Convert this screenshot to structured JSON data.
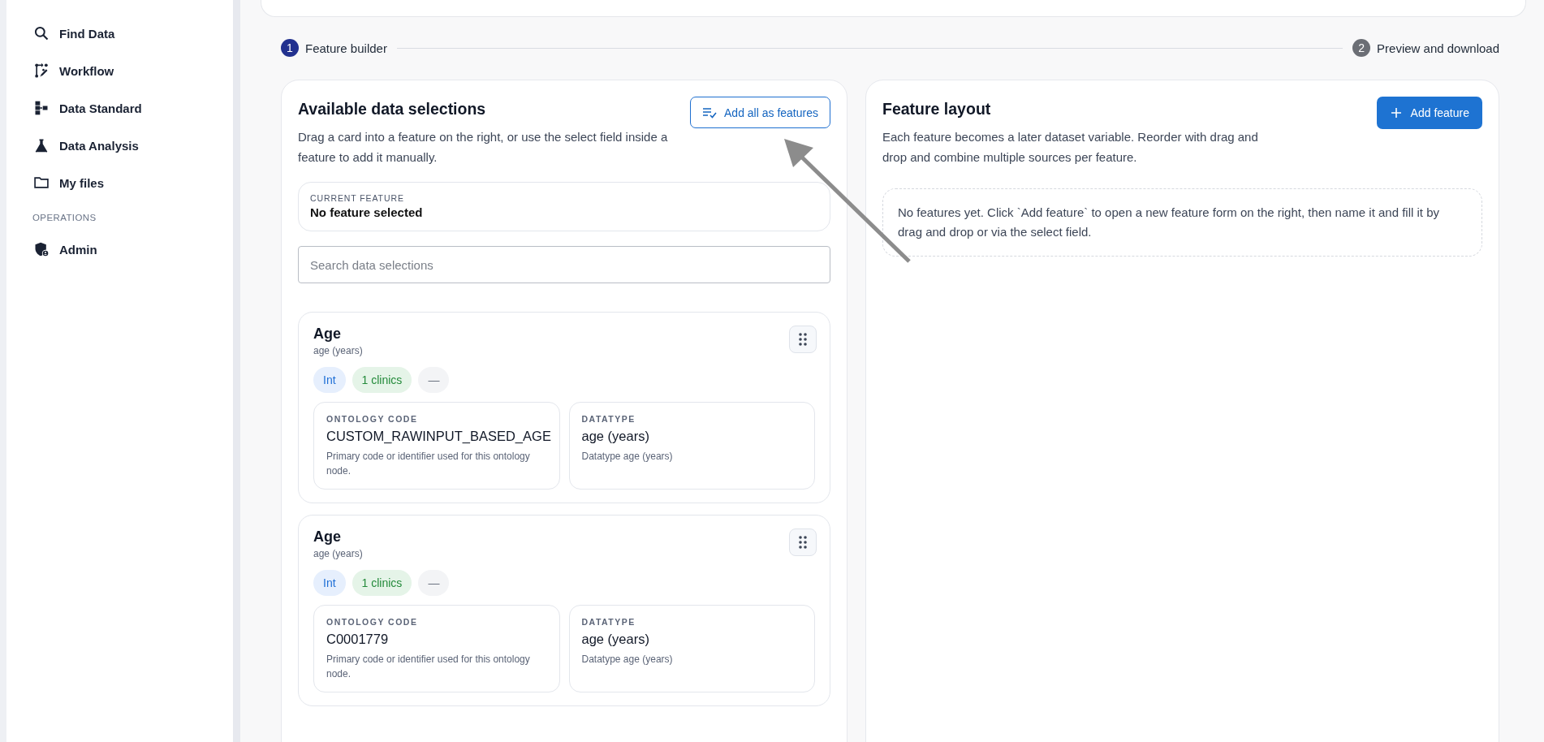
{
  "sidebar": {
    "groups": [
      {
        "items": [
          {
            "label": "Find Data"
          },
          {
            "label": "Workflow"
          },
          {
            "label": "Data Standard"
          },
          {
            "label": "Data Analysis"
          },
          {
            "label": "My files"
          }
        ]
      },
      {
        "heading": "OPERATIONS",
        "items": [
          {
            "label": "Admin"
          }
        ]
      }
    ]
  },
  "stepper": {
    "steps": [
      {
        "number": "1",
        "label": "Feature builder",
        "selected": true
      },
      {
        "number": "2",
        "label": "Preview and download",
        "selected": false
      }
    ]
  },
  "available_panel": {
    "title": "Available data selections",
    "description": "Drag a card into a feature on the right, or use the select field inside a feature to add it manually.",
    "button": "Add all as features",
    "current_feature": {
      "label": "CURRENT FEATURE",
      "value": "No feature selected"
    },
    "search": {
      "placeholder": "Search data selections"
    },
    "cards": [
      {
        "title": "Age",
        "subtitle": "age (years)",
        "tags": [
          {
            "label": "Int",
            "kind": "type"
          },
          {
            "label": "1 clinics",
            "kind": "clinics"
          },
          {
            "label": "—",
            "kind": "neutral"
          }
        ],
        "fields": [
          {
            "label": "ONTOLOGY CODE",
            "value": "CUSTOM_RAWINPUT_BASED_AGE",
            "hint": "Primary code or identifier used for this ontology node."
          },
          {
            "label": "DATATYPE",
            "value": "age (years)",
            "hint": "Datatype age (years)"
          }
        ]
      },
      {
        "title": "Age",
        "subtitle": "age (years)",
        "tags": [
          {
            "label": "Int",
            "kind": "type"
          },
          {
            "label": "1 clinics",
            "kind": "clinics"
          },
          {
            "label": "—",
            "kind": "neutral"
          }
        ],
        "fields": [
          {
            "label": "ONTOLOGY CODE",
            "value": "C0001779",
            "hint": "Primary code or identifier used for this ontology node."
          },
          {
            "label": "DATATYPE",
            "value": "age (years)",
            "hint": "Datatype age (years)"
          }
        ]
      }
    ]
  },
  "layout_panel": {
    "title": "Feature layout",
    "description": "Each feature becomes a later dataset variable. Reorder with drag and drop and combine multiple sources per feature.",
    "button": "Add feature",
    "empty_message": "No features yet. Click `Add feature` to open a new feature form on the right, then name it and fill it by drag and drop or via the select field."
  }
}
